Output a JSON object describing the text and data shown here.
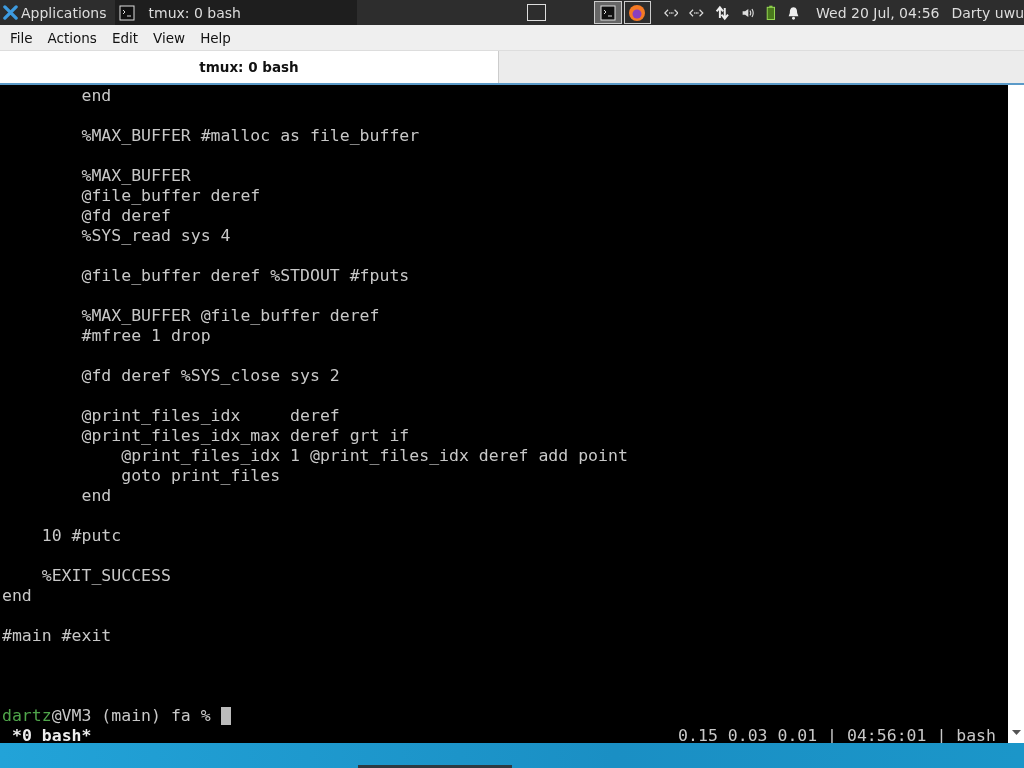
{
  "panel": {
    "menu_label": "Applications",
    "task": {
      "title": "tmux: 0 bash",
      "selected": true
    },
    "clock": "Wed 20 Jul, 04:56",
    "user": "Darty uwu"
  },
  "menu_bar": [
    "File",
    "Actions",
    "Edit",
    "View",
    "Help"
  ],
  "tabs": [
    {
      "label": "tmux: 0 bash",
      "selected": true
    }
  ],
  "terminal": {
    "blocks": [
      [
        "        end"
      ],
      [
        "        %MAX_BUFFER #malloc as file_buffer"
      ],
      [
        "        %MAX_BUFFER",
        "        @file_buffer deref",
        "        @fd deref",
        "        %SYS_read sys 4"
      ],
      [
        "        @file_buffer deref %STDOUT #fputs"
      ],
      [
        "        %MAX_BUFFER @file_buffer deref",
        "        #mfree 1 drop"
      ],
      [
        "        @fd deref %SYS_close sys 2"
      ],
      [
        "        @print_files_idx     deref",
        "        @print_files_idx_max deref grt if",
        "            @print_files_idx 1 @print_files_idx deref add point",
        "            goto print_files",
        "        end"
      ],
      [
        "    10 #putc"
      ],
      [
        "    %EXIT_SUCCESS",
        "end"
      ],
      [
        "#main #exit"
      ]
    ],
    "prompt": {
      "user": "dartz",
      "rest": "@VM3 (main) fa %"
    },
    "status": {
      "window": "*0 bash*",
      "right": "0.15 0.03 0.01 | 04:56:01 | bash"
    }
  }
}
